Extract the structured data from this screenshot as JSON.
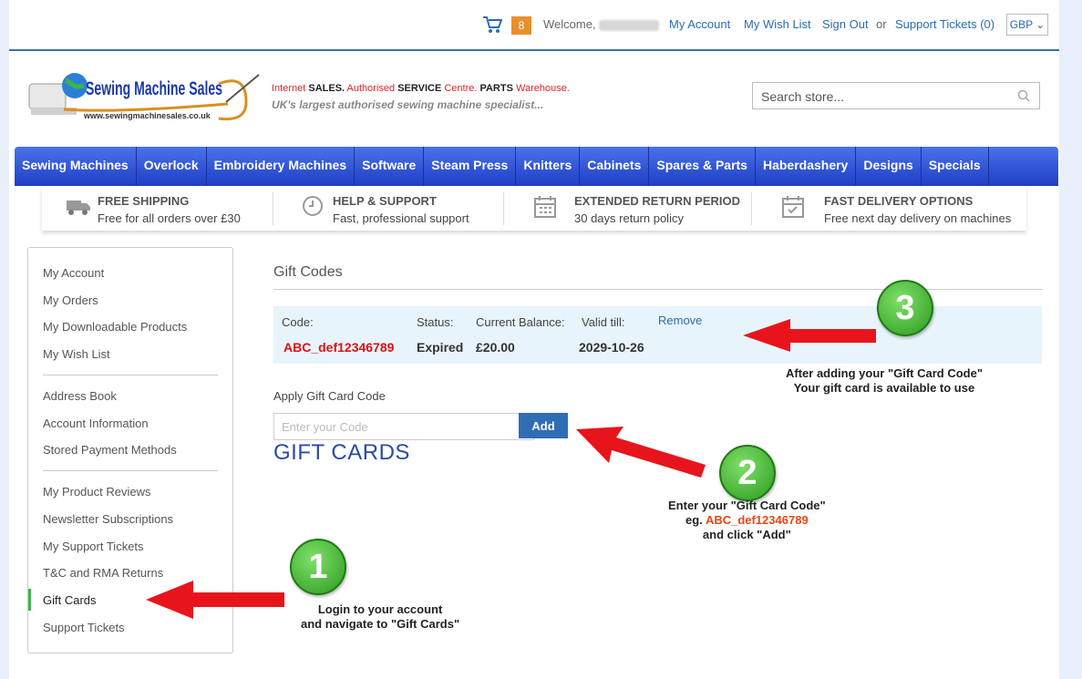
{
  "topbar": {
    "cart_count": "8",
    "welcome": "Welcome,",
    "links": [
      "My Account",
      "My Wish List",
      "Sign Out"
    ],
    "or": "or",
    "support_tickets": "Support Tickets (0)",
    "currency": "GBP"
  },
  "header": {
    "logo_name": "Sewing Machine Sales",
    "logo_url": "www.sewingmachinesales.co.uk",
    "tagline_1": "Internet SALES. Authorised SERVICE Centre. PARTS Warehouse.",
    "tagline_2": "UK's largest authorised sewing machine specialist...",
    "search_placeholder": "Search store..."
  },
  "nav": [
    "Sewing Machines",
    "Overlock",
    "Embroidery Machines",
    "Software",
    "Steam Press",
    "Knitters",
    "Cabinets",
    "Spares & Parts",
    "Haberdashery",
    "Designs",
    "Specials"
  ],
  "features": [
    {
      "title": "FREE SHIPPING",
      "sub": "Free for all orders over £30",
      "icon": "truck-icon"
    },
    {
      "title": "HELP & SUPPORT",
      "sub": "Fast, professional support",
      "icon": "clock-icon"
    },
    {
      "title": "EXTENDED RETURN PERIOD",
      "sub": "30 days return policy",
      "icon": "calendar-icon"
    },
    {
      "title": "FAST DELIVERY OPTIONS",
      "sub": "Free next day delivery on machines",
      "icon": "calendar-check-icon"
    }
  ],
  "sidebar": {
    "group1": [
      "My Account",
      "My Orders",
      "My Downloadable Products",
      "My Wish List"
    ],
    "group2": [
      "Address Book",
      "Account Information",
      "Stored Payment Methods"
    ],
    "group3": [
      "My Product Reviews",
      "Newsletter Subscriptions",
      "My Support Tickets",
      "T&C and RMA Returns",
      "Gift Cards",
      "Support Tickets"
    ]
  },
  "main": {
    "title": "Gift Codes",
    "labels": {
      "code": "Code:",
      "status": "Status:",
      "balance": "Current Balance:",
      "valid": "Valid till:"
    },
    "code": "ABC_def12346789",
    "status": "Expired",
    "balance": "£20.00",
    "valid": "2029-10-26",
    "remove": "Remove",
    "apply_label": "Apply Gift Card Code",
    "apply_placeholder": "Enter your Code",
    "add_button": "Add",
    "heading": "GIFT CARDS"
  },
  "annotations": {
    "step1": {
      "num": "1",
      "line1": "Login to your account",
      "line2": "and navigate to \"Gift Cards\""
    },
    "step2": {
      "num": "2",
      "line1": "Enter your \"Gift Card Code\"",
      "line2_prefix": "eg.",
      "line2_code": "ABC_def12346789",
      "line3": "and click \"Add\""
    },
    "step3": {
      "num": "3",
      "line1": "After adding your \"Gift Card Code\"",
      "line2": "Your gift card is available to use"
    },
    "accent_green": "#3bb54a",
    "arrow_red": "#e8141c"
  }
}
